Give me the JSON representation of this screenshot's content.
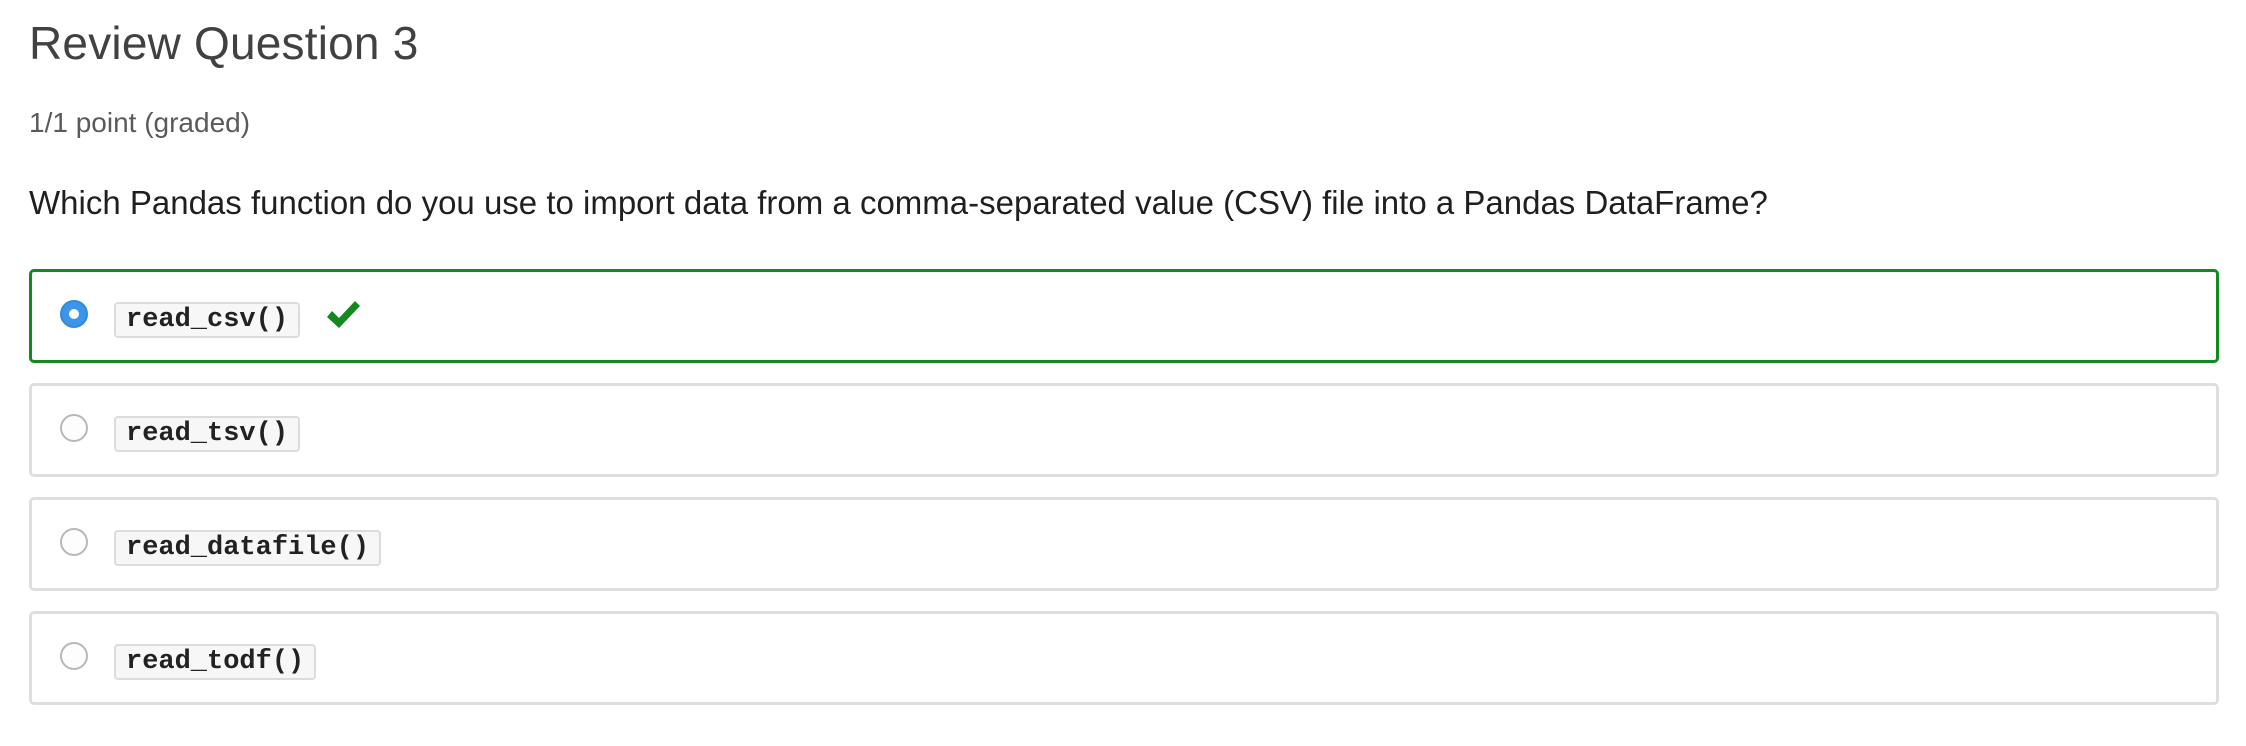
{
  "problem": {
    "title": "Review Question 3",
    "points": "1/1 point (graded)",
    "question": "Which Pandas function do you use to import data from a comma-separated value (CSV) file into a Pandas DataFrame?"
  },
  "options": [
    {
      "label": "read_csv()",
      "selected": true,
      "correct": true
    },
    {
      "label": "read_tsv()",
      "selected": false,
      "correct": false
    },
    {
      "label": "read_datafile()",
      "selected": false,
      "correct": false
    },
    {
      "label": "read_todf()",
      "selected": false,
      "correct": false
    }
  ],
  "colors": {
    "correct_border": "#138a1d",
    "checkmark": "#138a1d",
    "radio_selected": "#3d95ea",
    "option_border": "#dedede"
  },
  "icons": {
    "correct_indicator": "checkmark-icon"
  }
}
